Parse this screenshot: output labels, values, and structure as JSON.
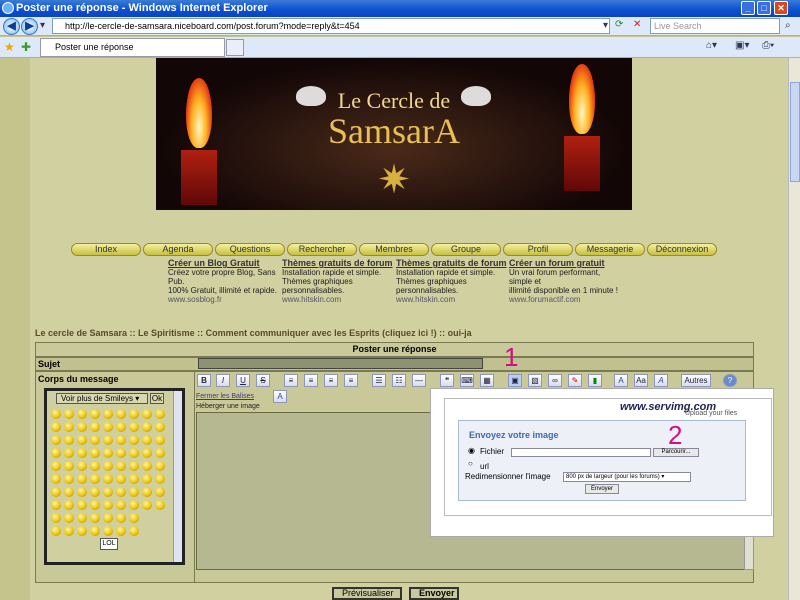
{
  "window": {
    "title": "Poster une réponse - Windows Internet Explorer"
  },
  "browser": {
    "url": "http://le-cercle-de-samsara.niceboard.com/post.forum?mode=reply&t=454",
    "search_placeholder": "Live Search",
    "tab_label": "Poster une réponse"
  },
  "banner": {
    "line1": "Le Cercle de",
    "line2": "SamsarA"
  },
  "nav": [
    "Index",
    "Agenda",
    "Questions",
    "Rechercher",
    "Membres",
    "Groupe",
    "Profil",
    "Messagerie",
    "Déconnexion"
  ],
  "ads": [
    {
      "title": "Créer un Blog Gratuit",
      "body": [
        "Créez votre propre Blog, Sans",
        "Pub.",
        "100% Gratuit, illimité et rapide."
      ],
      "url": "www.sosblog.fr"
    },
    {
      "title": "Thèmes gratuits de forum",
      "body": [
        "Installation rapide et simple.",
        "Thèmes graphiques",
        "personnalisables."
      ],
      "url": "www.hitskin.com"
    },
    {
      "title": "Thèmes gratuits de forum",
      "body": [
        "Installation rapide et simple.",
        "Thèmes graphiques",
        "personnalisables."
      ],
      "url": "www.hitskin.com"
    },
    {
      "title": "Créer un forum gratuit",
      "body": [
        "Un vrai forum performant,",
        "simple et",
        "illimité disponible en 1 minute !"
      ],
      "url": "www.forumactif.com"
    }
  ],
  "breadcrumb": "Le cercle de Samsara  :: Le Spiritisme :: Comment communiquer avec les Esprits (cliquez ici !) :: oui-ja",
  "form": {
    "header": "Poster une réponse",
    "subject_label": "Sujet",
    "body_label": "Corps du message",
    "smiley_select": "Voir plus de Smileys",
    "smiley_ok": "Ok",
    "smiley_extra": "LOL",
    "autres": "Autres",
    "fermer": "Fermer les Balises",
    "heberger": "Héberger une image",
    "preview": "Prévisualiser",
    "send": "Envoyer"
  },
  "servimg": {
    "logo": "www.servimg.com",
    "tagline": "Upload your files",
    "title": "Envoyez votre image",
    "fichier": "Fichier",
    "parcourir": "Parcourir...",
    "url": "url",
    "resize_label": "Redimensionner l'image",
    "resize_value": "800 px de largeur (pour les forums)",
    "envoyer": "Envoyer"
  },
  "annotations": {
    "one": "1",
    "two": "2"
  },
  "colors": {
    "page_bg": "#c4c48c",
    "form_header": "#c9c99c",
    "annotation": "#d01080",
    "titlebar": "#0b4fd0"
  }
}
